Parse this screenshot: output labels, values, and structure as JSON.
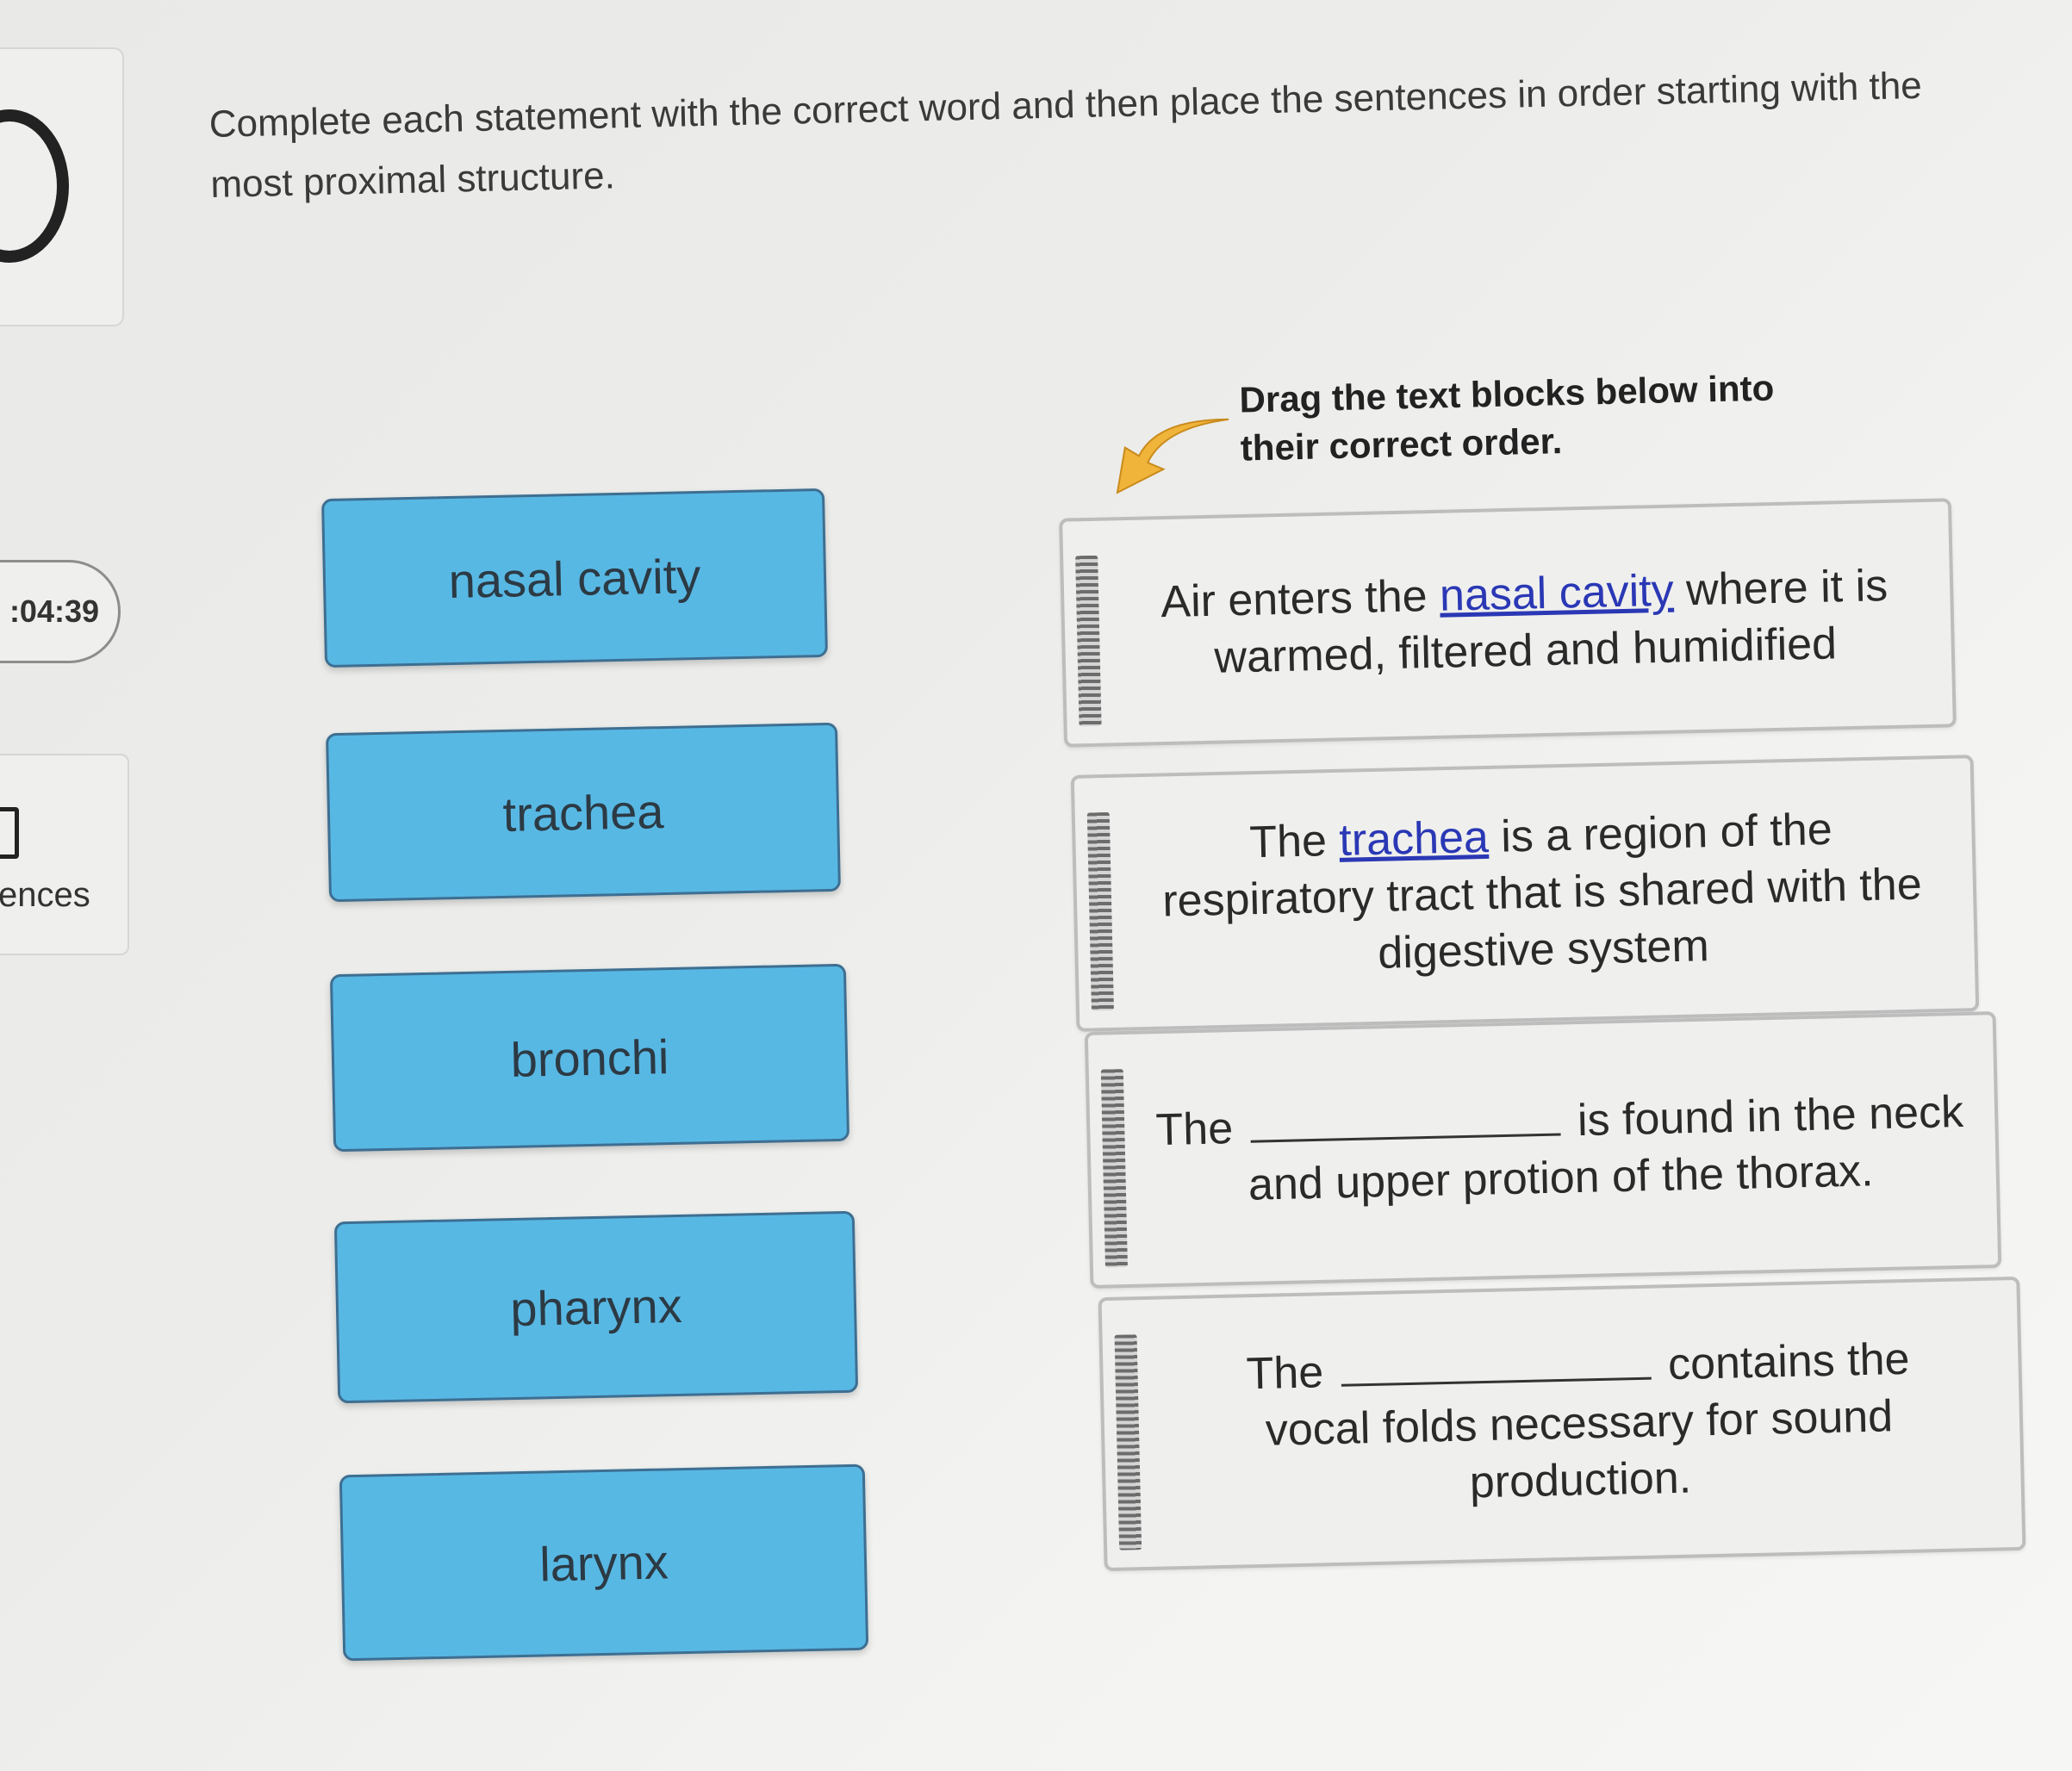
{
  "sidebar": {
    "timer": ":04:39",
    "references_label": "ences"
  },
  "instructions": "Complete each statement with the correct word and then place the sentences in order starting with the most proximal structure.",
  "drag_hint": "Drag the text blocks below into their correct order.",
  "colors": {
    "word_block": "#58b8e4",
    "arrow": "#f0b43a",
    "answer_link": "#2a38b5"
  },
  "word_bank": [
    "nasal cavity",
    "trachea",
    "bronchi",
    "pharynx",
    "larynx"
  ],
  "sentences": [
    {
      "before": "Air enters the",
      "answer": "nasal cavity",
      "after": "where it is warmed, filtered and humidified"
    },
    {
      "before": "The",
      "answer": "trachea",
      "after": "is a region of the respiratory tract that is shared with the digestive system"
    },
    {
      "before": "The",
      "blank": "",
      "after": "is found in the neck and upper protion of the thorax."
    },
    {
      "before": "The",
      "blank": "",
      "after": "contains the vocal folds necessary for sound production."
    }
  ]
}
